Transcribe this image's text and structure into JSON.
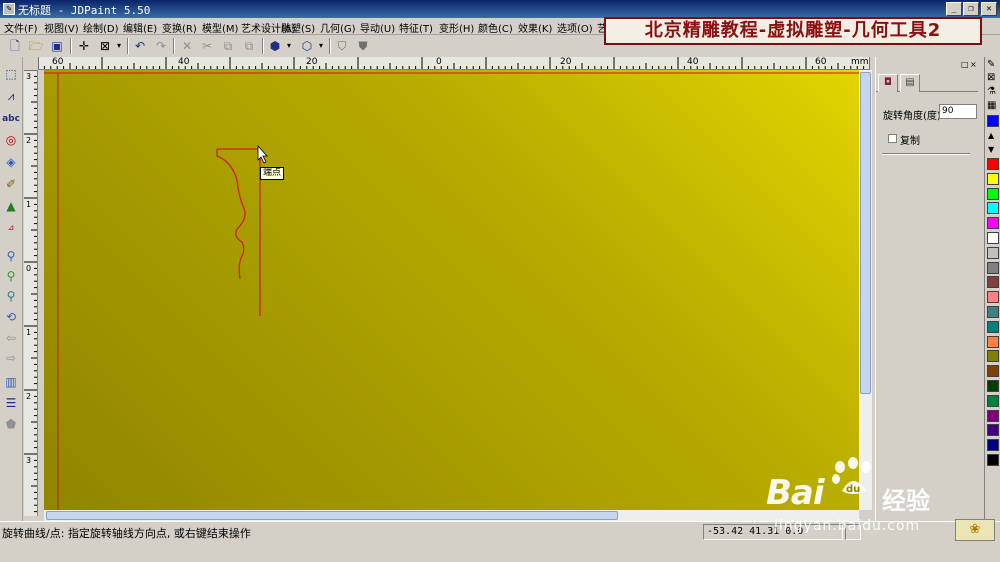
{
  "window": {
    "title": "无标题 - JDPaint 5.50",
    "buttons": [
      "_",
      "❐",
      "✕"
    ]
  },
  "menu": [
    "文件(F)",
    "视图(V)",
    "绘制(D)",
    "编辑(E)",
    "变换(R)",
    "模型(M)",
    "艺术设计(A)",
    "雕塑(S)",
    "几何(G)",
    "导动(U)",
    "特征(T)",
    "变形(H)",
    "颜色(C)",
    "效果(K)",
    "选项(O)",
    "艺"
  ],
  "banner": "北京精雕教程-虚拟雕塑-几何工具2",
  "rulers": {
    "unit": "mm",
    "h_ticks": [
      "60",
      "40",
      "20",
      "0",
      "20",
      "40",
      "60"
    ],
    "v_ticks": [
      "3",
      "2",
      "1",
      "0",
      "1",
      "2",
      "3"
    ]
  },
  "canvas": {
    "tooltip": "端点"
  },
  "panel": {
    "tabs": [
      "◘",
      "▤"
    ],
    "rotation_label": "旋转角度(度)",
    "rotation_value": "90",
    "copy_label": "复制",
    "copy_checked": false,
    "head_buttons": [
      "□",
      "×"
    ]
  },
  "palette": {
    "colors": [
      "#0000ff",
      "#ff0000",
      "#ffff00",
      "#00ff00",
      "#00ffff",
      "#ff00ff",
      "#ffffff",
      "#c0c0c0",
      "#808080",
      "#804040",
      "#ff8080",
      "#408080",
      "#008080",
      "#ff8040",
      "#808000",
      "#804000",
      "#004000",
      "#008040",
      "#800080",
      "#400080",
      "#000080",
      "#000000"
    ]
  },
  "status": {
    "text": "旋转曲线/点: 指定旋转轴线方向点, 或右键结束操作",
    "coords": "-53.42  41.31  0.0"
  },
  "watermark": {
    "logo": "Bai",
    "logo_du": "du",
    "text": "经验",
    "url": "jingyan.baidu.com"
  },
  "colors": {
    "accent": "#0a246a",
    "canvas_light": "#e1d500",
    "canvas_dark": "#8f8500",
    "curve": "#d11e0e"
  }
}
